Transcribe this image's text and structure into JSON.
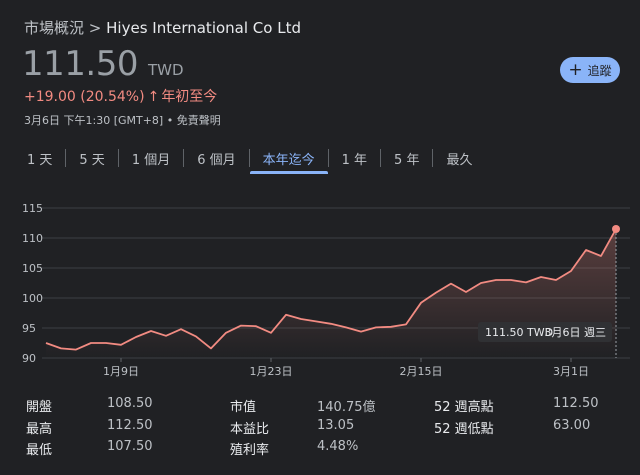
{
  "breadcrumb": {
    "section": "市場概況",
    "separator": ">",
    "company": "Hiyes International Co Ltd"
  },
  "quote": {
    "price": "111.50",
    "currency": "TWD",
    "change": "+19.00 (20.54%)",
    "change_arrow": "↑",
    "change_period": "年初至今",
    "timestamp": "3月6日 下午1:30 [GMT+8] • 免責聲明"
  },
  "follow_button": {
    "label": "追蹤",
    "icon": "plus-icon"
  },
  "tabs": [
    {
      "label": "1 天"
    },
    {
      "label": "5 天"
    },
    {
      "label": "1 個月"
    },
    {
      "label": "6 個月"
    },
    {
      "label": "本年迄今",
      "active": true
    },
    {
      "label": "1 年"
    },
    {
      "label": "5 年"
    },
    {
      "label": "最久"
    }
  ],
  "colors": {
    "line": "#f28b82",
    "accent": "#8ab4f8",
    "background": "#202124",
    "grid": "#3c4043"
  },
  "chart_data": {
    "type": "area",
    "ylim": [
      90,
      115
    ],
    "yticks": [
      90,
      95,
      100,
      105,
      110,
      115
    ],
    "x_tick_labels": [
      {
        "label": "1月9日",
        "x": 5
      },
      {
        "label": "1月23日",
        "x": 15
      },
      {
        "label": "2月15日",
        "x": 25
      },
      {
        "label": "3月1日",
        "x": 35
      }
    ],
    "x": [
      0,
      1,
      2,
      3,
      4,
      5,
      6,
      7,
      8,
      9,
      10,
      11,
      12,
      13,
      14,
      15,
      16,
      17,
      18,
      19,
      20,
      21,
      22,
      23,
      24,
      25,
      26,
      27,
      28,
      29,
      30,
      31,
      32,
      33,
      34,
      35,
      36,
      37,
      38,
      39
    ],
    "values": [
      92.5,
      91.6,
      91.4,
      92.5,
      92.5,
      92.2,
      93.5,
      94.5,
      93.7,
      94.8,
      93.6,
      91.6,
      94.2,
      95.4,
      95.3,
      94.2,
      97.2,
      96.5,
      96.1,
      95.7,
      95.1,
      94.4,
      95.1,
      95.2,
      95.6,
      99.2,
      100.9,
      102.4,
      101.0,
      102.5,
      103.0,
      103.0,
      102.6,
      103.5,
      103.0,
      104.5,
      108.0,
      107.0,
      111.5
    ],
    "tooltip": {
      "price": "111.50 TWD",
      "date": "3月6日 週三"
    },
    "grid": true,
    "legend": "none"
  },
  "stats": [
    [
      {
        "label": "開盤",
        "value": "108.50"
      },
      {
        "label": "市值",
        "value": "140.75億"
      },
      {
        "label": "52 週高點",
        "value": "112.50"
      }
    ],
    [
      {
        "label": "最高",
        "value": "112.50"
      },
      {
        "label": "本益比",
        "value": "13.05"
      },
      {
        "label": "52 週低點",
        "value": "63.00"
      }
    ],
    [
      {
        "label": "最低",
        "value": "107.50"
      },
      {
        "label": "殖利率",
        "value": "4.48%"
      }
    ]
  ]
}
